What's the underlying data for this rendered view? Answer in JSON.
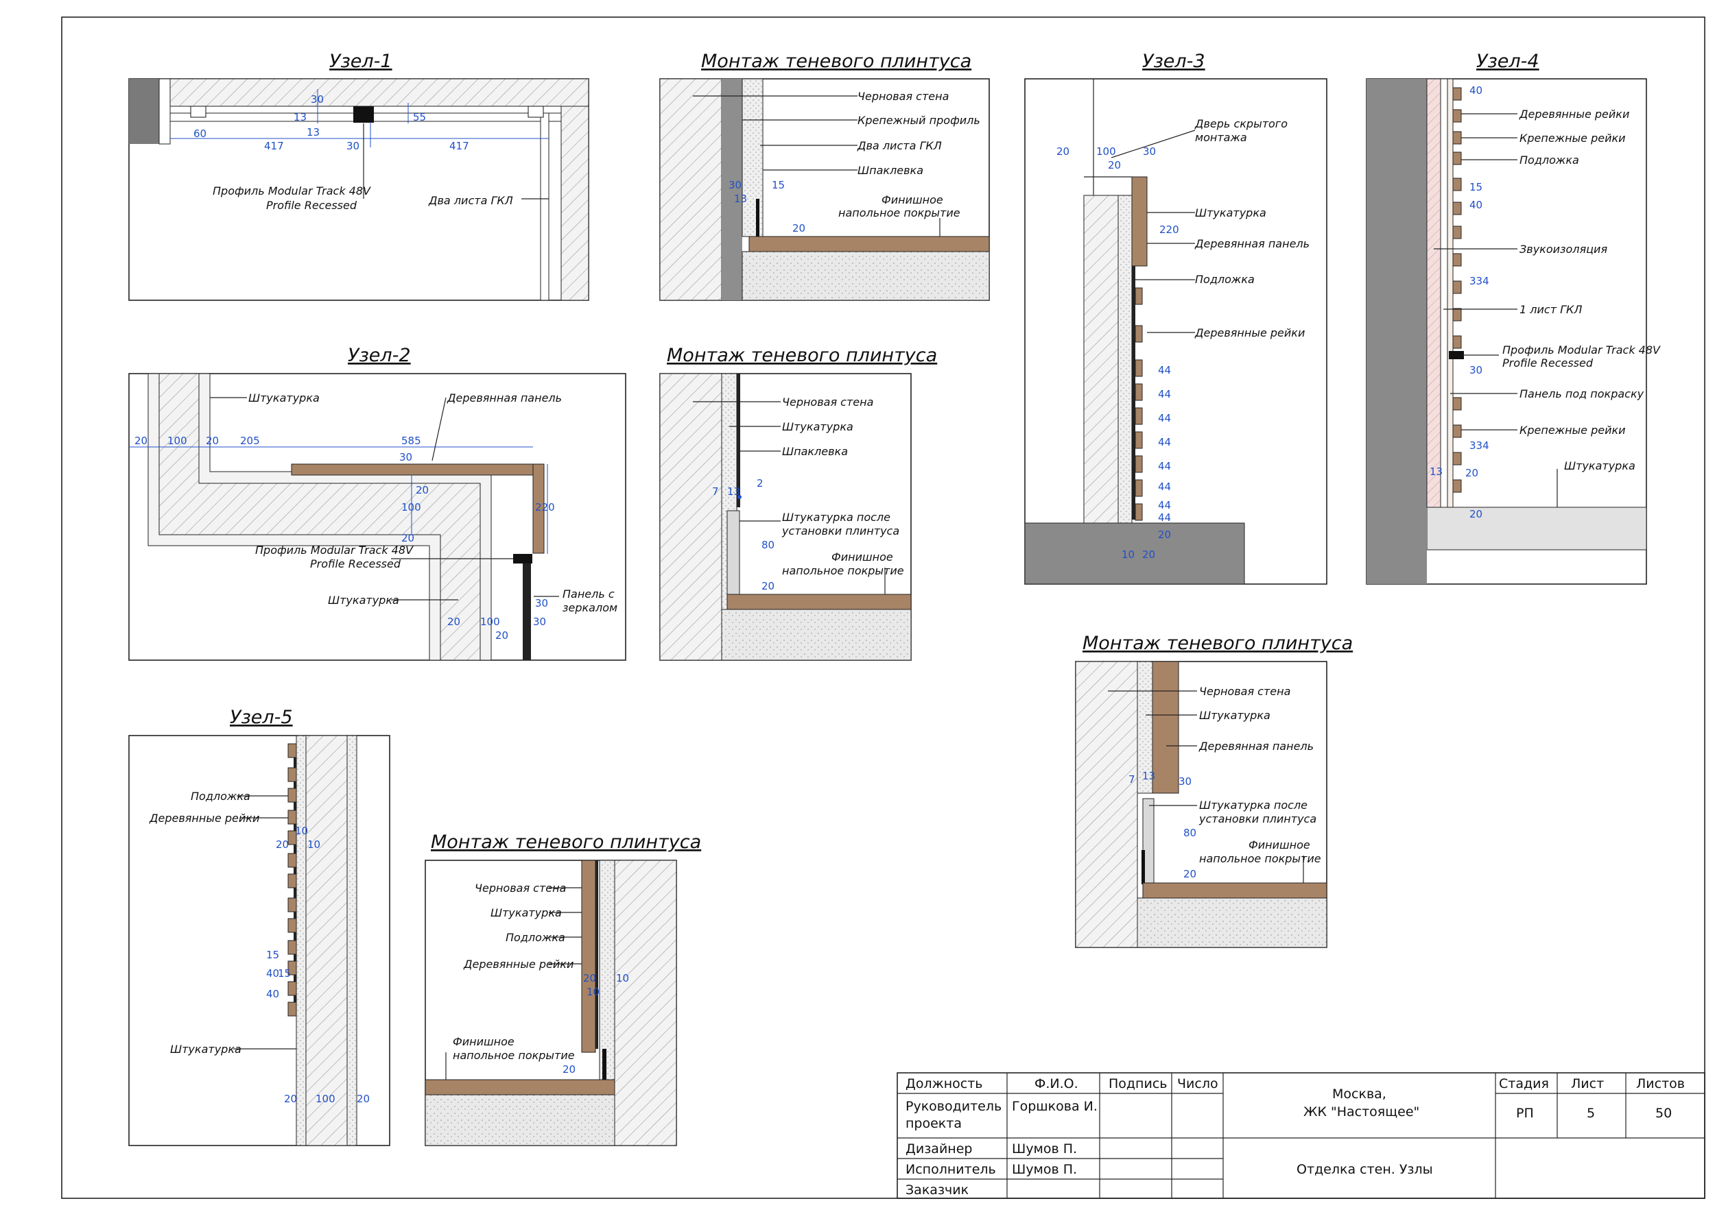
{
  "colors": {
    "wood": "#a88466",
    "plaster": "#ececec",
    "wall_hatch": "#d6d6d6",
    "dim": "#2050c8",
    "dark_profile": "#111111",
    "floor": "#e2e2e2",
    "concrete": "#8a8a8a"
  },
  "details": {
    "uzel1": {
      "title": "Узел-1",
      "labels": [
        "Профиль Modular Track 48V",
        "Profile Recessed",
        "Два листа ГКЛ"
      ],
      "dims": [
        "30",
        "13",
        "13",
        "55",
        "60",
        "417",
        "30",
        "417"
      ]
    },
    "uzel2": {
      "title": "Узел-2",
      "labels": [
        "Штукатурка",
        "Деревянная панель",
        "Профиль Modular Track 48V",
        "Profile Recessed",
        "Штукатурка",
        "Панель с",
        "зеркалом"
      ],
      "dims": [
        "20",
        "100",
        "20",
        "205",
        "585",
        "30",
        "20",
        "100",
        "220",
        "20",
        "30",
        "20",
        "100",
        "20",
        "30"
      ]
    },
    "uzel3": {
      "title": "Узел-3",
      "labels": [
        "Дверь скрытого",
        "монтажа",
        "Штукатурка",
        "Деревянная панель",
        "Подложка",
        "Деревянные рейки"
      ],
      "dims": [
        "20",
        "100",
        "30",
        "20",
        "220",
        "44",
        "44",
        "44",
        "44",
        "44",
        "44",
        "44",
        "44",
        "20",
        "10",
        "20"
      ]
    },
    "uzel4": {
      "title": "Узел-4",
      "labels": [
        "Деревянные рейки",
        "Крепежные рейки",
        "Подложка",
        "Звукоизоляция",
        "1 лист ГКЛ",
        "Профиль Modular Track 48V",
        "Profile Recessed",
        "Панель под покраску",
        "Крепежные рейки",
        "Штукатурка"
      ],
      "dims": [
        "40",
        "15",
        "40",
        "334",
        "30",
        "334",
        "13",
        "20",
        "20"
      ]
    },
    "uzel5": {
      "title": "Узел-5",
      "labels": [
        "Подложка",
        "Деревянные рейки",
        "Штукатурка"
      ],
      "dims": [
        "10",
        "20",
        "10",
        "15",
        "40",
        "15",
        "40",
        "20",
        "100",
        "20"
      ]
    },
    "plinth_a": {
      "title": "Монтаж теневого плинтуса",
      "labels": [
        "Черновая стена",
        "Крепежный профиль",
        "Два листа ГКЛ",
        "Шпаклевка",
        "Финишное",
        "напольное покрытие"
      ],
      "dims": [
        "30",
        "13",
        "15",
        "20"
      ]
    },
    "plinth_b": {
      "title": "Монтаж теневого плинтуса",
      "labels": [
        "Черновая стена",
        "Штукатурка",
        "Шпаклевка",
        "Штукатурка после",
        "установки плинтуса",
        "Финишное",
        "напольное покрытие"
      ],
      "dims": [
        "7",
        "13",
        "2",
        "80",
        "20"
      ]
    },
    "plinth_c": {
      "title": "Монтаж теневого плинтуса",
      "labels": [
        "Черновая стена",
        "Штукатурка",
        "Деревянная панель",
        "Штукатурка после",
        "установки плинтуса",
        "Финишное",
        "напольное покрытие"
      ],
      "dims": [
        "7",
        "13",
        "30",
        "80",
        "20"
      ]
    },
    "plinth_d": {
      "title": "Монтаж теневого плинтуса",
      "labels": [
        "Черновая стена",
        "Штукатурка",
        "Подложка",
        "Деревянные рейки",
        "Финишное",
        "напольное покрытие"
      ],
      "dims": [
        "20",
        "10",
        "10",
        "20"
      ]
    }
  },
  "title_block": {
    "headers": {
      "position": "Должность",
      "name": "Ф.И.О.",
      "signature": "Подпись",
      "date": "Число",
      "stage": "Стадия",
      "sheet": "Лист",
      "sheets": "Листов"
    },
    "rows": [
      {
        "position": "Руководитель",
        "position2": "проекта",
        "name": "Горшкова И."
      },
      {
        "position": "Дизайнер",
        "name": "Шумов П."
      },
      {
        "position": "Исполнитель",
        "name": "Шумов П."
      },
      {
        "position": "Заказчик",
        "name": ""
      }
    ],
    "project_city": "Москва,",
    "project_name": "ЖК \"Настоящее\"",
    "drawing_title": "Отделка стен. Узлы",
    "stage": "РП",
    "sheet": "5",
    "sheets": "50"
  }
}
